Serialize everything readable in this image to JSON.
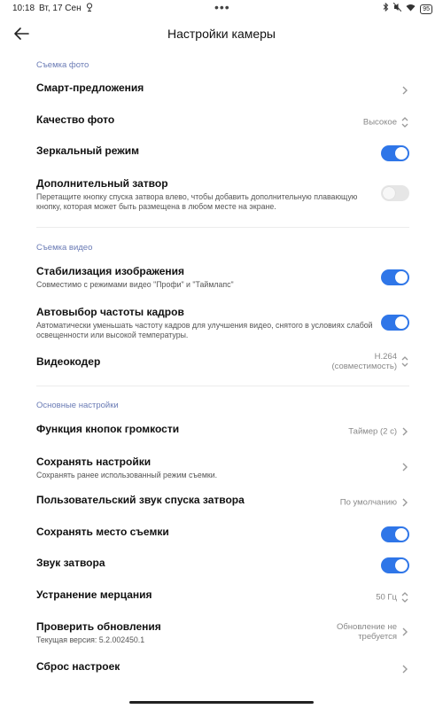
{
  "status_bar": {
    "time": "10:18",
    "date": "Вт, 17 Сен",
    "battery": "95"
  },
  "header": {
    "title": "Настройки камеры"
  },
  "photo_section": {
    "title": "Съемка фото",
    "smart_suggestions": {
      "label": "Смарт-предложения"
    },
    "photo_quality": {
      "label": "Качество фото",
      "value": "Высокое"
    },
    "mirror_mode": {
      "label": "Зеркальный режим",
      "on": true
    },
    "extra_shutter": {
      "label": "Дополнительный затвор",
      "description": "Перетащите кнопку спуска затвора влево, чтобы добавить дополнительную плавающую кнопку, которая может быть размещена в любом месте на экране.",
      "on": false
    }
  },
  "video_section": {
    "title": "Съемка видео",
    "stabilization": {
      "label": "Стабилизация изображения",
      "description": "Совместимо с режимами видео \"Профи\" и \"Таймлапс\"",
      "on": true
    },
    "auto_fps": {
      "label": "Автовыбор частоты кадров",
      "description": "Автоматически уменьшать частоту кадров для улучшения видео, снятого в условиях слабой освещенности или высокой температуры.",
      "on": true
    },
    "video_encoder": {
      "label": "Видеокодер",
      "value_line1": "H.264",
      "value_line2": "(совместимость)"
    }
  },
  "general_section": {
    "title": "Основные настройки",
    "volume_buttons": {
      "label": "Функция кнопок громкости",
      "value": "Таймер (2 с)"
    },
    "save_settings": {
      "label": "Сохранять настройки",
      "description": "Сохранять ранее использованный режим съемки."
    },
    "custom_shutter_sound": {
      "label": "Пользовательский звук спуска затвора",
      "value": "По умолчанию"
    },
    "save_location": {
      "label": "Сохранять место съемки",
      "on": true
    },
    "shutter_sound": {
      "label": "Звук затвора",
      "on": true
    },
    "anti_flicker": {
      "label": "Устранение мерцания",
      "value": "50 Гц"
    },
    "check_updates": {
      "label": "Проверить обновления",
      "description": "Текущая версия: 5.2.002450.1",
      "value_line1": "Обновление не",
      "value_line2": "требуется"
    },
    "reset": {
      "label": "Сброс настроек"
    }
  }
}
